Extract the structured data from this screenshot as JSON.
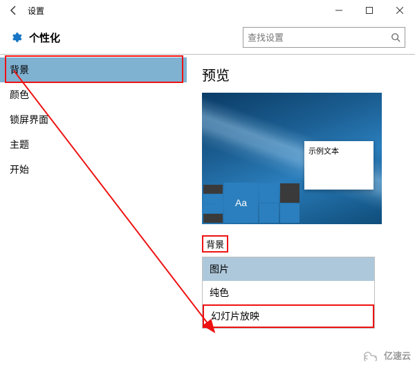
{
  "titlebar": {
    "title": "设置"
  },
  "header": {
    "title": "个性化"
  },
  "search": {
    "placeholder": "查找设置"
  },
  "sidebar": {
    "items": [
      {
        "label": "背景",
        "active": true
      },
      {
        "label": "颜色"
      },
      {
        "label": "锁屏界面"
      },
      {
        "label": "主题"
      },
      {
        "label": "开始"
      }
    ]
  },
  "main": {
    "preview_heading": "预览",
    "sample_text": "示例文本",
    "tile_aa": "Aa",
    "bg_label": "背景",
    "dropdown": {
      "options": [
        {
          "label": "图片",
          "selected": true
        },
        {
          "label": "纯色"
        },
        {
          "label": "幻灯片放映",
          "highlight": true
        }
      ]
    }
  },
  "watermark": "亿速云"
}
